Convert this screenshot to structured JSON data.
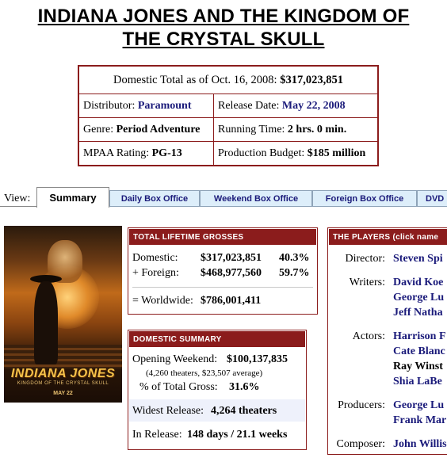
{
  "title": "INDIANA JONES AND THE KINGDOM OF THE CRYSTAL SKULL",
  "summary": {
    "domestic_label": "Domestic Total as of Oct. 16, 2008:",
    "domestic_value": "$317,023,851",
    "distributor_label": "Distributor:",
    "distributor_value": "Paramount",
    "release_label": "Release Date:",
    "release_value": "May 22, 2008",
    "genre_label": "Genre:",
    "genre_value": "Period Adventure",
    "runtime_label": "Running Time:",
    "runtime_value": "2 hrs. 0 min.",
    "mpaa_label": "MPAA Rating:",
    "mpaa_value": "PG-13",
    "budget_label": "Production Budget:",
    "budget_value": "$185 million"
  },
  "tabs": {
    "view_label": "View:",
    "items": [
      "Summary",
      "Daily Box Office",
      "Weekend Box Office",
      "Foreign Box Office",
      "DVD"
    ]
  },
  "poster": {
    "logo": "INDIANA JONES",
    "subtitle": "KINGDOM OF THE CRYSTAL SKULL",
    "date": "MAY 22"
  },
  "lifetime": {
    "header": "TOTAL LIFETIME GROSSES",
    "domestic_label": "Domestic:",
    "domestic_value": "$317,023,851",
    "domestic_pct": "40.3%",
    "foreign_label": "+ Foreign:",
    "foreign_value": "$468,977,560",
    "foreign_pct": "59.7%",
    "worldwide_label": "= Worldwide:",
    "worldwide_value": "$786,001,411"
  },
  "domestic_summary": {
    "header": "DOMESTIC SUMMARY",
    "opening_label": "Opening Weekend:",
    "opening_value": "$100,137,835",
    "opening_detail": "(4,260 theaters, $23,507 average)",
    "pct_label": "% of Total Gross:",
    "pct_value": "31.6%",
    "widest_label": "Widest Release:",
    "widest_value": "4,264 theaters",
    "inrelease_label": "In Release:",
    "inrelease_value": "148 days / 21.1 weeks"
  },
  "players": {
    "header": "THE PLAYERS (click name",
    "director_label": "Director:",
    "directors": [
      "Steven Spi"
    ],
    "writers_label": "Writers:",
    "writers": [
      "David Koe",
      "George Lu",
      "Jeff Natha"
    ],
    "actors_label": "Actors:",
    "actors": [
      "Harrison F",
      "Cate Blanc",
      "Ray Winst",
      "Shia LaBe"
    ],
    "producers_label": "Producers:",
    "producers": [
      "George Lu",
      "Frank Mar"
    ],
    "composer_label": "Composer:",
    "composers": [
      "John Willis"
    ]
  },
  "colors": {
    "header_red": "#8b1c1c",
    "link_navy": "#1a1a7a",
    "tab_bg": "#ddeefa"
  }
}
